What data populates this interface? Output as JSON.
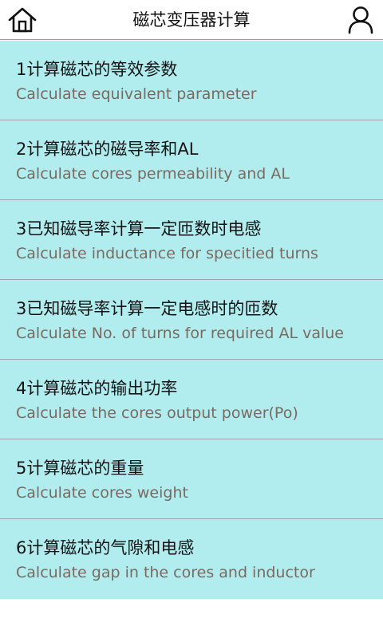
{
  "header": {
    "title": "磁芯变压器计算",
    "home_icon": "home-icon",
    "user_icon": "user-icon"
  },
  "menu": {
    "items": [
      {
        "zh": "1计算磁芯的等效参数",
        "en": "Calculate equivalent parameter"
      },
      {
        "zh": "2计算磁芯的磁导率和AL",
        "en": "Calculate cores permeability and AL"
      },
      {
        "zh": "3已知磁导率计算一定匝数时电感",
        "en": "Calculate inductance for specitied turns"
      },
      {
        "zh": "3已知磁导率计算一定电感时的匝数",
        "en": "Calculate No. of turns for required AL value"
      },
      {
        "zh": "4计算磁芯的输出功率",
        "en": "Calculate the cores output power(Po)"
      },
      {
        "zh": "5计算磁芯的重量",
        "en": "Calculate cores weight"
      },
      {
        "zh": "6计算磁芯的气隙和电感",
        "en": "Calculate gap in the cores and inductor"
      }
    ]
  },
  "colors": {
    "item_background": "#b1ecef",
    "title_text": "#111111",
    "subtitle_text": "#7b6a5e",
    "divider": "#9aa6a8"
  }
}
